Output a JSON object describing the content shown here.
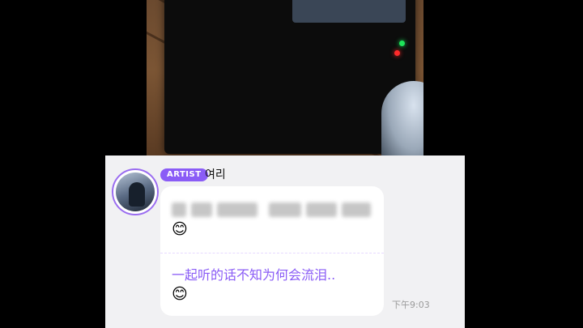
{
  "artist_badge": "ARTIST",
  "sender_name": "여리",
  "message": {
    "line1_emoji": "😊",
    "translation": "一起听的话不知为何会流泪..",
    "line2_emoji": "😊"
  },
  "timestamp": "下午9:03",
  "colors": {
    "accent": "#8a5cf6",
    "chat_bg": "#f1f1f3",
    "bubble_bg": "#ffffff"
  }
}
